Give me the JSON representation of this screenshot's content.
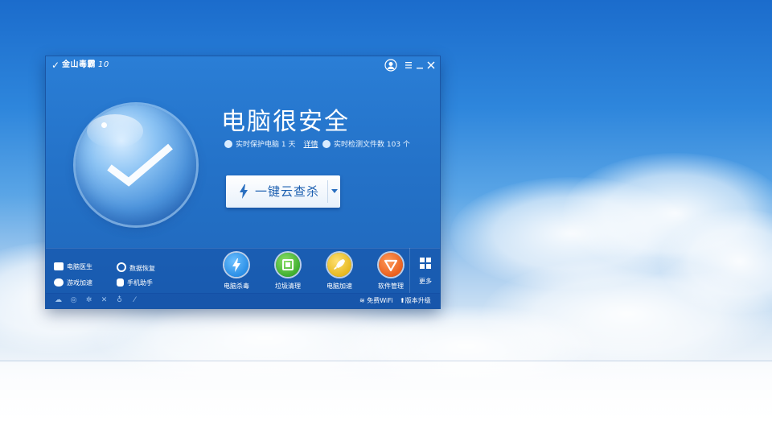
{
  "app": {
    "title": "金山毒霸",
    "version": "10"
  },
  "titlebar": {
    "user_icon": "user-icon",
    "menu_icon": "menu-icon",
    "minimize_icon": "minimize-icon",
    "close_icon": "close-icon"
  },
  "status": {
    "title": "电脑很安全",
    "protect_text": "实时保护电脑 1 天",
    "detail_link": "详情",
    "scan_count_text": "实时检测文件数 103 个"
  },
  "scan_button": {
    "label": "一键云查杀"
  },
  "tools": [
    {
      "label": "电脑医生",
      "icon": "medkit-icon"
    },
    {
      "label": "数据恢复",
      "icon": "restore-icon"
    },
    {
      "label": "游戏加速",
      "icon": "gamepad-icon"
    },
    {
      "label": "手机助手",
      "icon": "phone-hand-icon"
    }
  ],
  "features": [
    {
      "label": "电脑杀毒",
      "icon": "bolt-icon",
      "color": "#2b8fe6"
    },
    {
      "label": "垃圾清理",
      "icon": "trash-icon",
      "color": "#3fae2f"
    },
    {
      "label": "电脑加速",
      "icon": "rocket-icon",
      "color": "#e6b820"
    },
    {
      "label": "软件管理",
      "icon": "software-icon",
      "color": "#e9601e"
    }
  ],
  "more": {
    "label": "更多"
  },
  "footer": {
    "icons": [
      "cloud-icon",
      "gear-icon",
      "settings-icon",
      "tools-icon",
      "bug-icon",
      "leaf-icon"
    ],
    "wifi_label": "免费WiFi",
    "upgrade_label": "版本升级"
  },
  "colors": {
    "window_blue": "#2472c8",
    "accent_text": "#1c5fb0"
  }
}
